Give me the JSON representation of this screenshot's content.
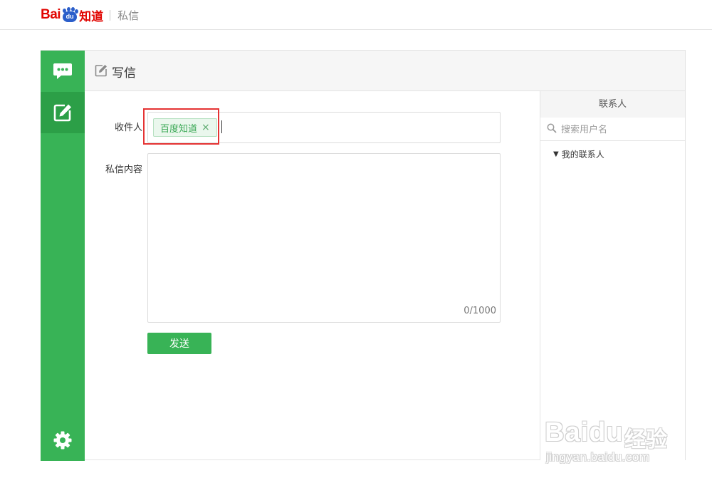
{
  "header": {
    "logo_bai": "Bai",
    "logo_du": "du",
    "logo_zhidao": "知道",
    "section": "私信"
  },
  "sidebar": {
    "items": [
      {
        "name": "messages",
        "icon": "chat-bubble-icon",
        "active": false
      },
      {
        "name": "compose",
        "icon": "compose-icon",
        "active": true
      },
      {
        "name": "settings",
        "icon": "gear-icon",
        "active": false
      }
    ]
  },
  "compose": {
    "title": "写信",
    "recipient_label": "收件人",
    "recipient_tag": "百度知道",
    "recipient_tag_close": "×",
    "content_label": "私信内容",
    "content_value": "",
    "counter": "0/1000",
    "send_label": "发送"
  },
  "contacts": {
    "title": "联系人",
    "search_placeholder": "搜索用户名",
    "group_arrow": "▼",
    "group_label": "我的联系人"
  },
  "watermark": {
    "brand": "Baidu",
    "jingyan": "经验",
    "url": "jingyan.baidu.com"
  },
  "colors": {
    "brand_green": "#38b356",
    "active_green": "#2c9f47",
    "logo_red": "#e10602",
    "logo_blue": "#2b5eca",
    "highlight_red": "#e53333"
  }
}
